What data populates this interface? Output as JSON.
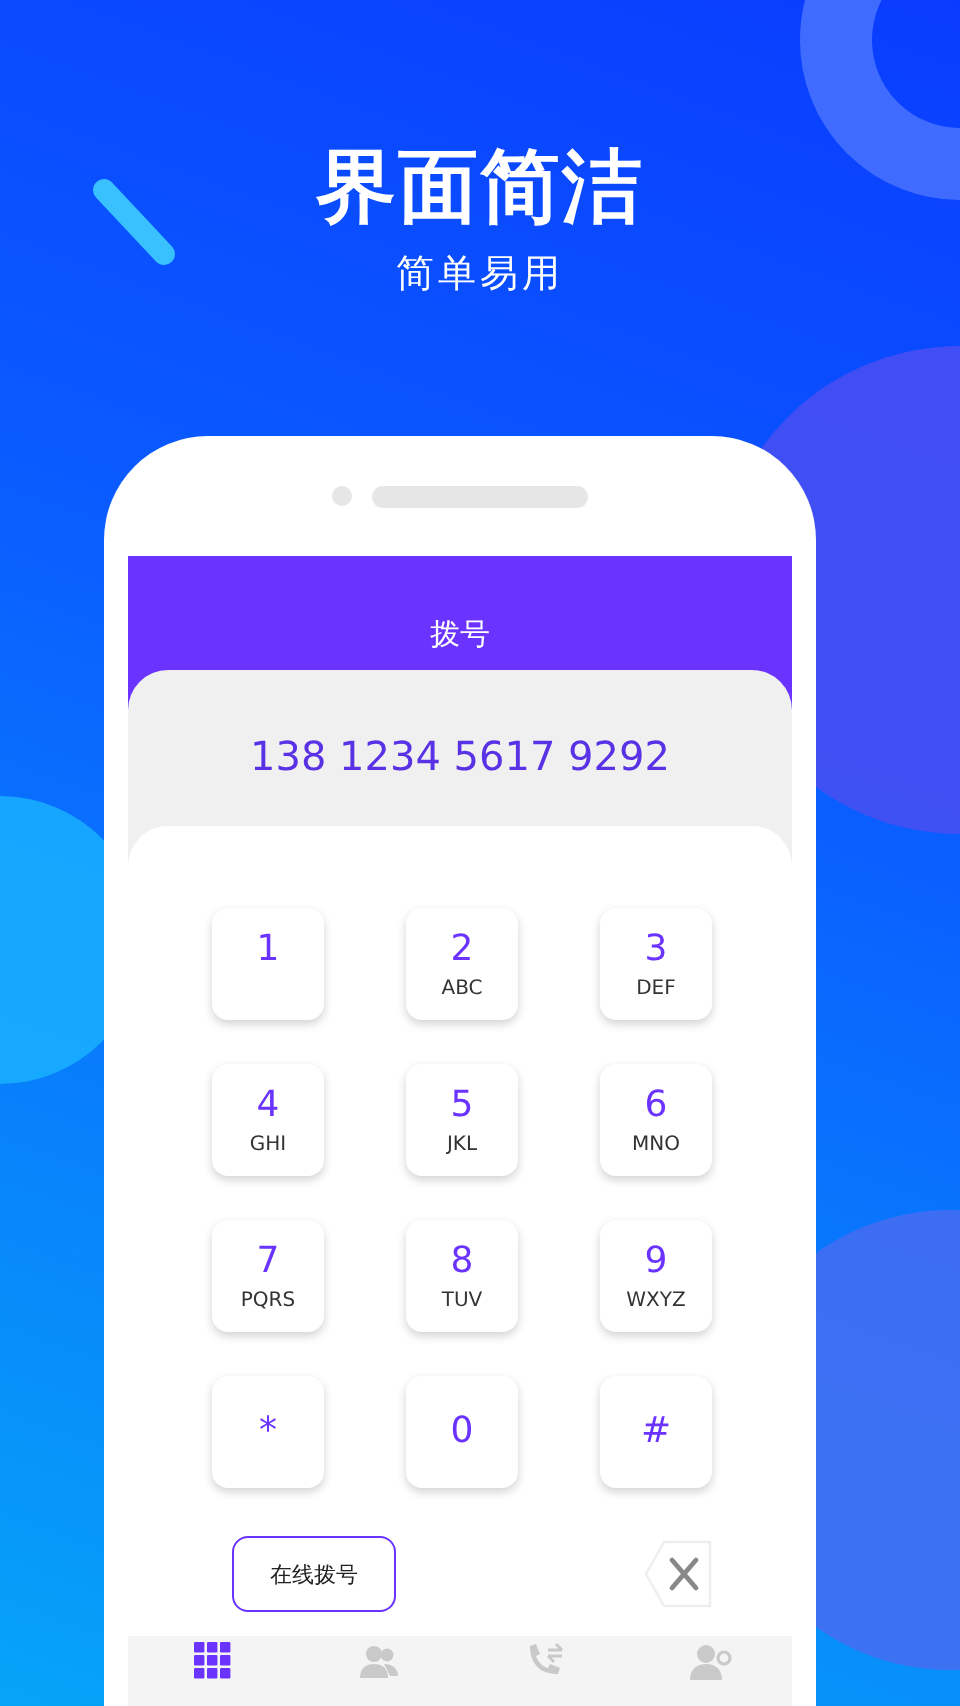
{
  "headline": "界面简洁",
  "subheadline": "简单易用",
  "screen": {
    "title": "拨号",
    "number": "138 1234 5617 9292",
    "keys": [
      {
        "digit": "1"
      },
      {
        "digit": "2",
        "letters": "ABC"
      },
      {
        "digit": "3",
        "letters": "DEF"
      },
      {
        "digit": "4",
        "letters": "GHI"
      },
      {
        "digit": "5",
        "letters": "JKL"
      },
      {
        "digit": "6",
        "letters": "MNO"
      },
      {
        "digit": "7",
        "letters": "PQRS"
      },
      {
        "digit": "8",
        "letters": "TUV"
      },
      {
        "digit": "9",
        "letters": "WXYZ"
      },
      {
        "digit": "*"
      },
      {
        "digit": "0"
      },
      {
        "digit": "#"
      }
    ],
    "online_dial_button": "在线拨号",
    "tabs": [
      {
        "kind": "dialpad",
        "selected": true
      },
      {
        "kind": "contacts",
        "selected": false
      },
      {
        "kind": "calls",
        "selected": false
      },
      {
        "kind": "profile",
        "selected": false
      }
    ]
  }
}
